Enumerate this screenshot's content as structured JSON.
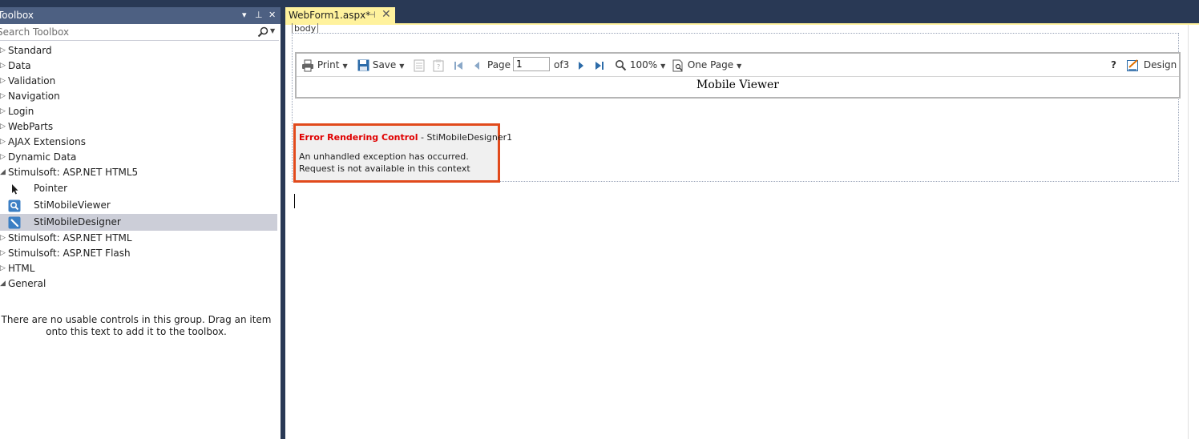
{
  "toolbox": {
    "title": "Toolbox",
    "header_buttons": {
      "dropdown": "▾",
      "pin": "⊥",
      "close": "✕"
    },
    "search_placeholder": "Search Toolbox",
    "groups": [
      {
        "label": "Standard",
        "expanded": false
      },
      {
        "label": "Data",
        "expanded": false
      },
      {
        "label": "Validation",
        "expanded": false
      },
      {
        "label": "Navigation",
        "expanded": false
      },
      {
        "label": "Login",
        "expanded": false
      },
      {
        "label": "WebParts",
        "expanded": false
      },
      {
        "label": "AJAX Extensions",
        "expanded": false
      },
      {
        "label": "Dynamic Data",
        "expanded": false
      },
      {
        "label": "Stimulsoft: ASP.NET HTML5",
        "expanded": true
      }
    ],
    "html5_items": [
      {
        "label": "Pointer",
        "icon": "pointer-icon",
        "selected": false
      },
      {
        "label": "StiMobileViewer",
        "icon": "viewer-icon",
        "selected": false
      },
      {
        "label": "StiMobileDesigner",
        "icon": "designer-icon",
        "selected": true
      }
    ],
    "groups_after": [
      {
        "label": "Stimulsoft: ASP.NET HTML",
        "expanded": false
      },
      {
        "label": "Stimulsoft: ASP.NET Flash",
        "expanded": false
      },
      {
        "label": "HTML",
        "expanded": false
      },
      {
        "label": "General",
        "expanded": true
      }
    ],
    "empty_message": "There are no usable controls in this group. Drag an item onto this text to add it to the toolbox."
  },
  "document": {
    "tab_label": "WebForm1.aspx*",
    "tab_pin": "⊣",
    "tab_close": "✕",
    "tag_breadcrumb": "body"
  },
  "viewer": {
    "toolbar": {
      "print": "Print",
      "save": "Save",
      "page_label": "Page",
      "page_value": "1",
      "page_of": "of3",
      "zoom": "100%",
      "view_mode": "One Page",
      "help": "?",
      "design": "Design"
    },
    "title": "Mobile Viewer"
  },
  "error": {
    "title": "Error Rendering Control",
    "separator": " - ",
    "control_id": "StiMobileDesigner1",
    "line1": "An unhandled exception has occurred.",
    "line2": "Request is not available in this context"
  },
  "colors": {
    "chrome_background": "#293955",
    "toolbox_header": "#4d6082",
    "tab_active": "#fff29d",
    "selection": "#ccced8",
    "error_border": "#e14a1c",
    "error_title": "#e00000"
  }
}
